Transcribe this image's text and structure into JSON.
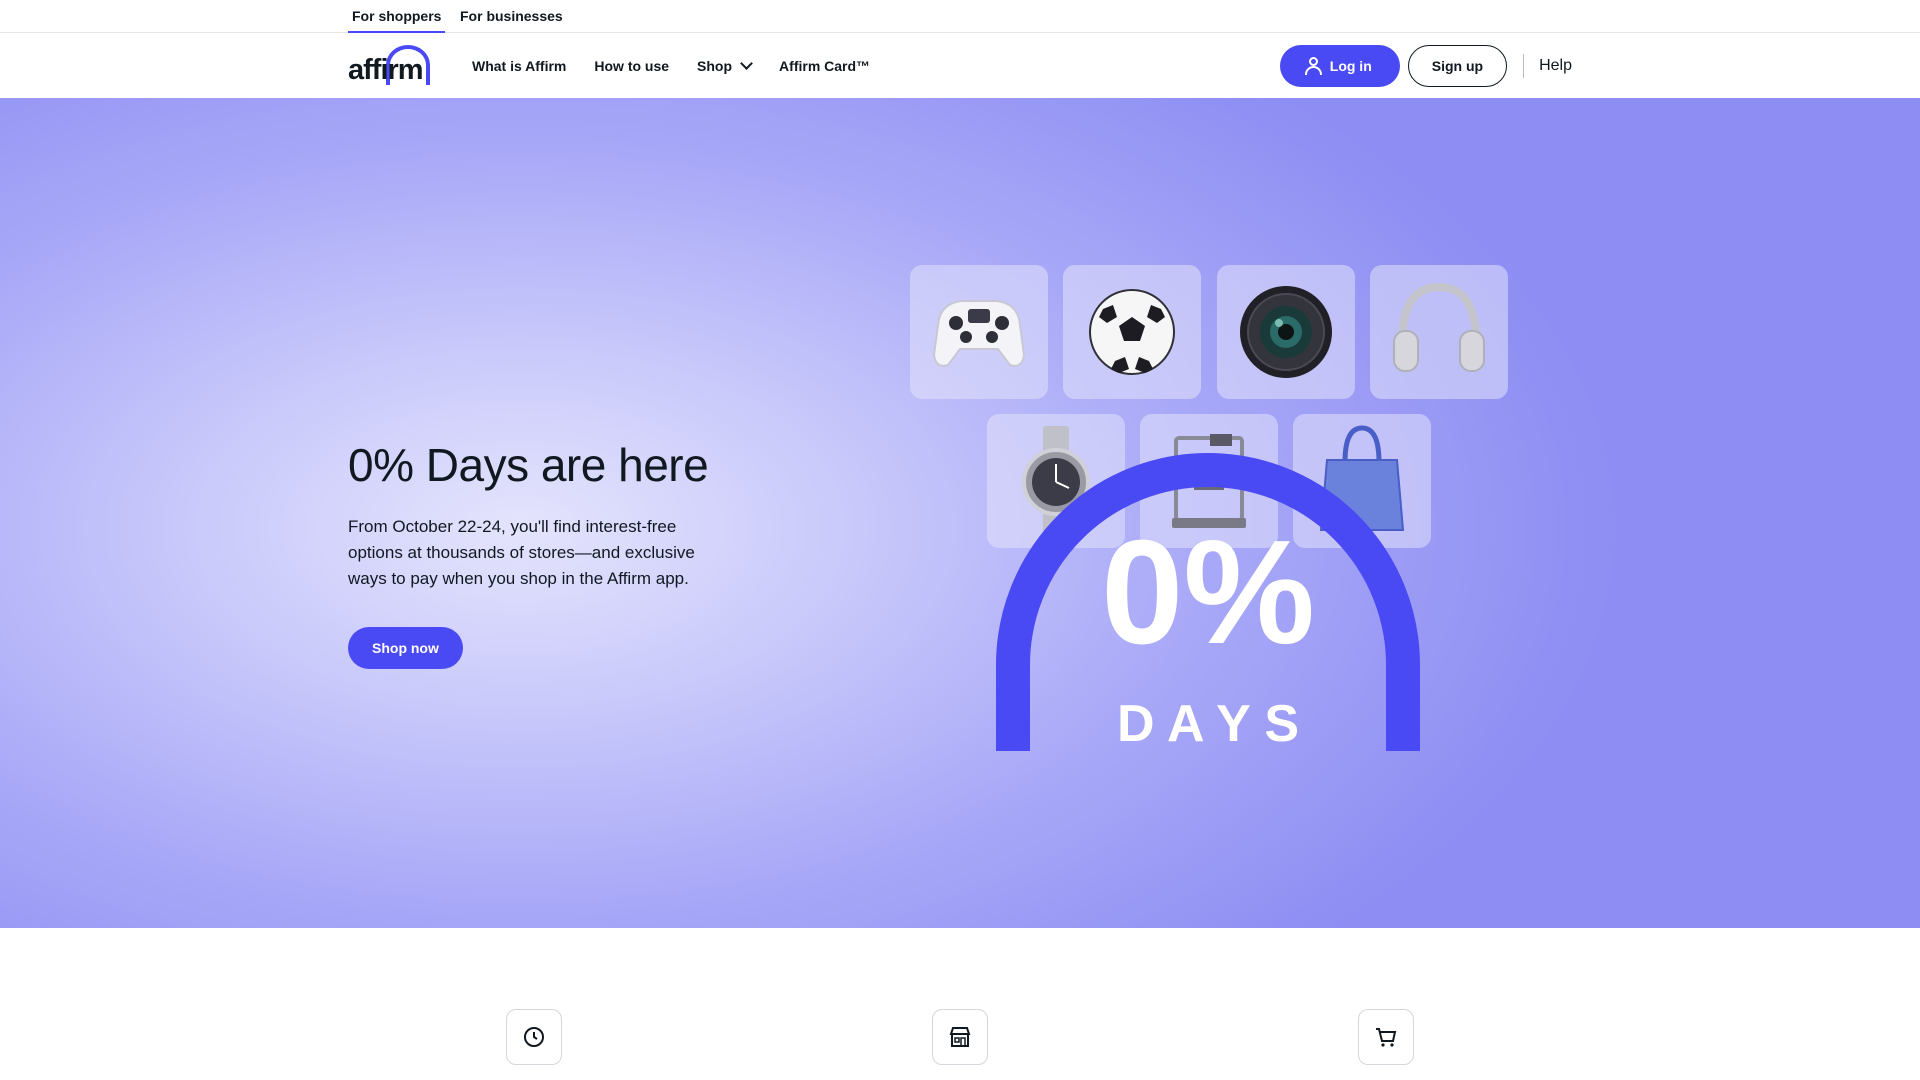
{
  "audience_tabs": [
    {
      "label": "For shoppers",
      "active": true
    },
    {
      "label": "For businesses",
      "active": false
    }
  ],
  "logo": {
    "text": "affirm",
    "brand_color": "#4a4af4"
  },
  "nav": {
    "items": [
      {
        "label": "What is Affirm"
      },
      {
        "label": "How to use"
      },
      {
        "label": "Shop",
        "icon": "chevron-down-icon"
      },
      {
        "label": "Affirm Card™"
      }
    ],
    "login_label": "Log in",
    "signup_label": "Sign up",
    "help_label": "Help"
  },
  "hero": {
    "title": "0% Days are here",
    "description": "From October 22-24, you'll find interest-free options at thousands of stores—and exclusive ways to pay when you shop in the Affirm app.",
    "cta_label": "Shop now",
    "badge": {
      "big_text": "0%",
      "small_text": "D A Y S"
    },
    "products": [
      "game-controller-icon",
      "soccer-ball-icon",
      "camera-lens-icon",
      "headphones-icon",
      "wristwatch-icon",
      "3d-printer-icon",
      "handbag-icon"
    ]
  },
  "features": [
    {
      "icon": "clock-icon"
    },
    {
      "icon": "store-icon"
    },
    {
      "icon": "cart-icon"
    }
  ],
  "colors": {
    "accent": "#4a4af4",
    "text": "#101820",
    "hero_bg": "#a9a9f8"
  }
}
